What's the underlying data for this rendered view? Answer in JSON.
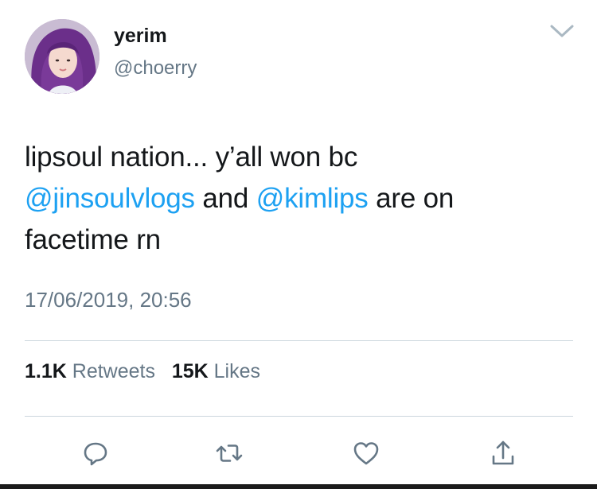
{
  "author": {
    "display_name": "yerim",
    "handle": "@choerry",
    "avatar_icon": "avatar-photo"
  },
  "tweet": {
    "line1": "lipsoul nation... y’all won bc",
    "mention1": "@jinsoulvlogs",
    "and_text": " and ",
    "mention2": "@kimlips",
    "line2_tail": " are on",
    "line3": "facetime rn"
  },
  "timestamp": "17/06/2019, 20:56",
  "stats": {
    "retweets_count": "1.1K",
    "retweets_label": "Retweets",
    "likes_count": "15K",
    "likes_label": "Likes"
  },
  "actions": [
    {
      "name": "reply",
      "icon": "reply-icon"
    },
    {
      "name": "retweet",
      "icon": "retweet-icon"
    },
    {
      "name": "like",
      "icon": "heart-icon"
    },
    {
      "name": "share",
      "icon": "share-icon"
    }
  ],
  "colors": {
    "text": "#14171a",
    "secondary": "#657786",
    "link": "#1da1f2",
    "divider": "#ccd6dd"
  }
}
